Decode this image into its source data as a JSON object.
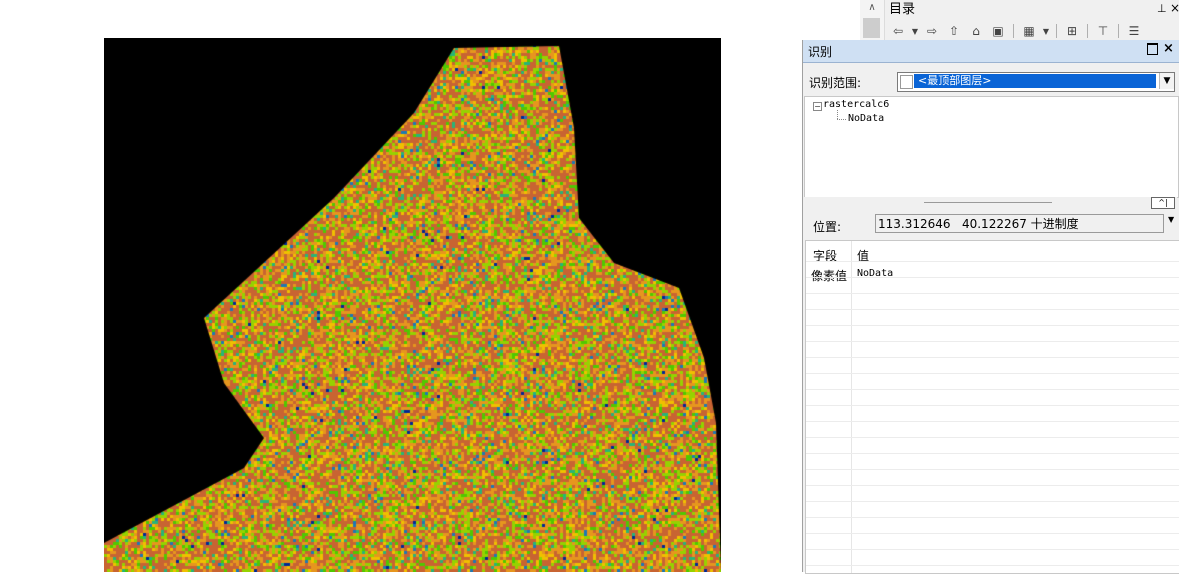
{
  "map": {
    "layer_colors": [
      "#c86432",
      "#e6961e",
      "#f0c000",
      "#96d200",
      "#50c800",
      "#28b478",
      "#1e78b4",
      "#002896"
    ],
    "background_color": "#000000"
  },
  "catalog": {
    "title": "目录",
    "pin_icon": "pin-icon",
    "close_icon": "close-icon",
    "toolbar_icons": [
      "back-icon",
      "dropdown-icon",
      "forward-icon",
      "up-folder-icon",
      "home-icon",
      "connect-folder-icon",
      "view-icon",
      "dropdown-icon",
      "add-data-icon",
      "tree-icon",
      "options-icon"
    ]
  },
  "identify": {
    "title": "识别",
    "scope_label": "识别范围:",
    "scope_value": "<最顶部图层>",
    "tree": {
      "layer": "rastercalc6",
      "child": "NoData"
    },
    "location_label": "位置:",
    "location_value": "113.312646   40.122267 十进制度",
    "table": {
      "col_field": "字段",
      "col_value": "值",
      "row_field": "像素值",
      "row_value": "NoData"
    },
    "accent_color": "#0a64d6"
  }
}
